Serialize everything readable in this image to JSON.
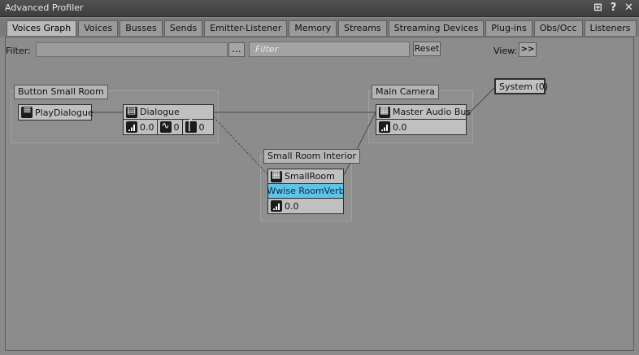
{
  "window": {
    "title": "Advanced Profiler"
  },
  "title_icons": [
    "grid-icon",
    "help-icon",
    "close-icon"
  ],
  "tabs": [
    {
      "label": "Voices Graph",
      "active": true
    },
    {
      "label": "Voices"
    },
    {
      "label": "Busses"
    },
    {
      "label": "Sends"
    },
    {
      "label": "Emitter-Listener"
    },
    {
      "label": "Memory"
    },
    {
      "label": "Streams"
    },
    {
      "label": "Streaming Devices"
    },
    {
      "label": "Plug-ins"
    },
    {
      "label": "Obs/Occ"
    },
    {
      "label": "Listeners"
    }
  ],
  "toolbar": {
    "filter_label": "Filter:",
    "filter_value": "",
    "dots_label": "...",
    "filter_placeholder": "Filter",
    "reset_label": "Reset",
    "view_label": "View:",
    "view_button": ">>"
  },
  "graph": {
    "groups": {
      "button_small_room": "Button Small Room",
      "main_camera": "Main Camera",
      "small_room_interior": "Small Room Interior"
    },
    "nodes": {
      "play_dialogue": "PlayDialogue",
      "dialogue": {
        "name": "Dialogue",
        "volume": "0.0",
        "lpf": "0",
        "hpf": "0"
      },
      "master_audio_bus": {
        "name": "Master Audio Bus",
        "volume": "0.0"
      },
      "system": "System (0)",
      "small_room": {
        "name": "SmallRoom",
        "effect": "Wwise RoomVerb",
        "volume": "0.0"
      }
    }
  },
  "colors": {
    "effect_bg": "#5ec3e6",
    "title_bg": "#444444"
  }
}
